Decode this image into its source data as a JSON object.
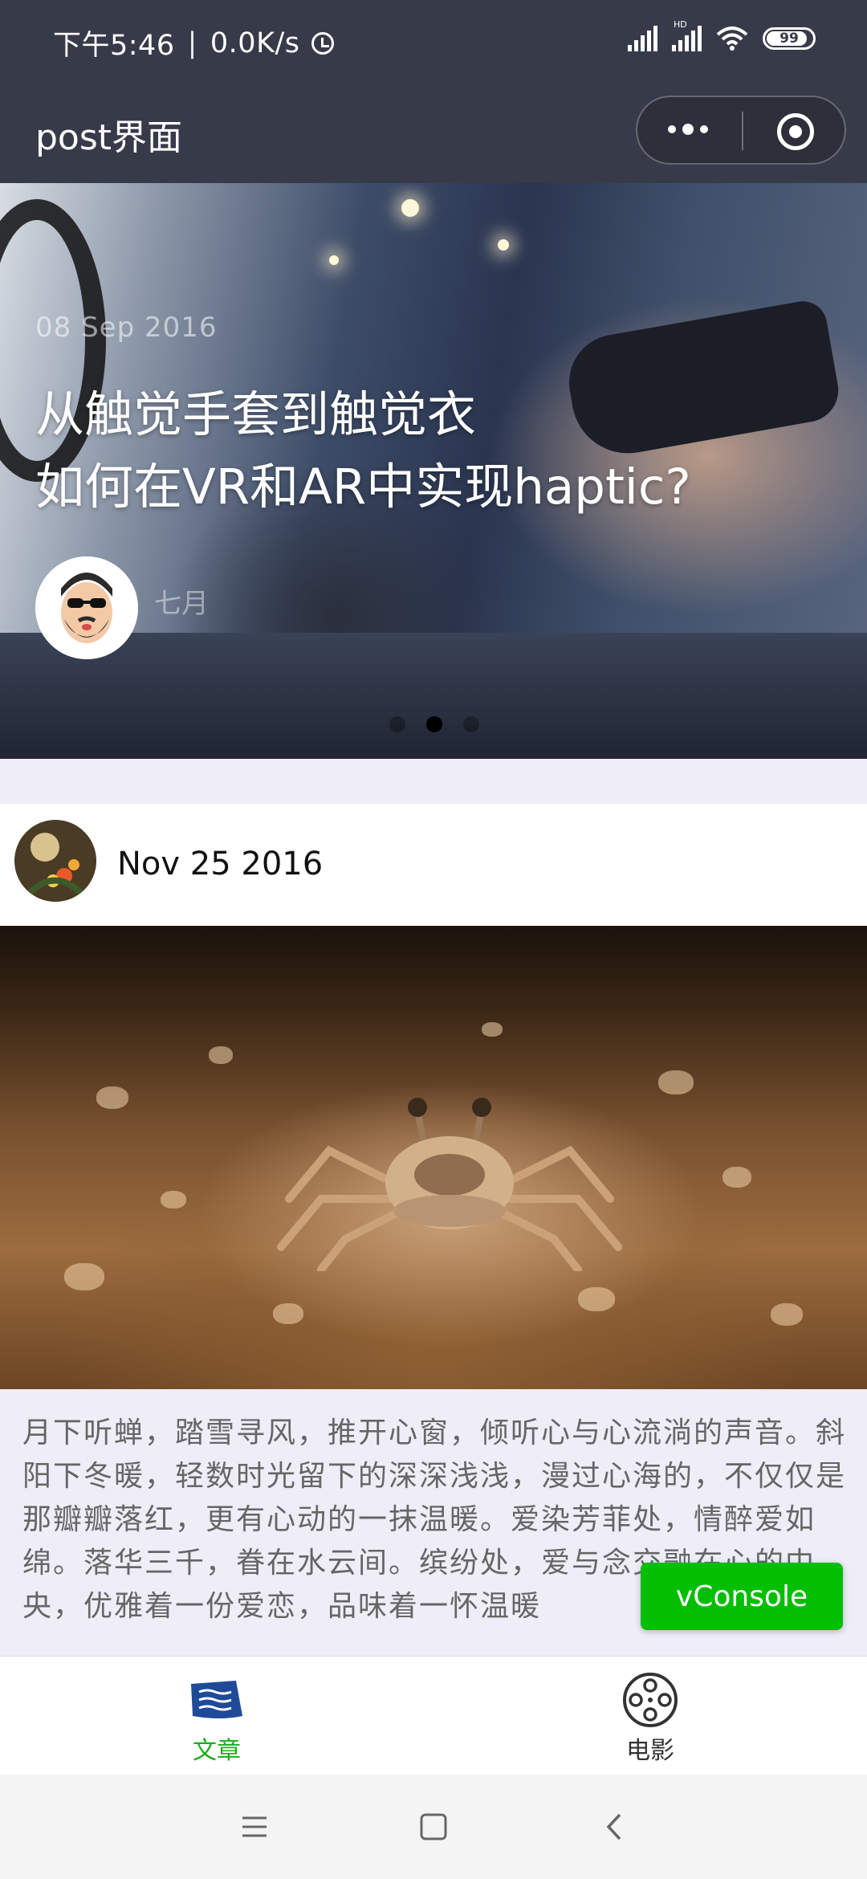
{
  "status_bar": {
    "time": "下午5:46",
    "network_speed": "0.0K/s",
    "battery": "99"
  },
  "nav": {
    "title": "post界面"
  },
  "banner": {
    "date": "08 Sep 2016",
    "title_line1": "从触觉手套到触觉衣",
    "title_line2": "如何在VR和AR中实现haptic?",
    "author": "七月",
    "indicator_count": 3,
    "active_index": 1
  },
  "post": {
    "date": "Nov 25 2016",
    "content": "月下听蝉，踏雪寻风，推开心窗，倾听心与心流淌的声音。斜阳下冬暖，轻数时光留下的深深浅浅，漫过心海的，不仅仅是那瓣瓣落红，更有心动的一抹温暖。爱染芳菲处，情醉爱如绵。落华三千，眷在水云间。缤纷处，爱与念交融在心的中央，优雅着一份爱恋，品味着一怀温暖"
  },
  "vconsole": {
    "label": "vConsole"
  },
  "tabbar": {
    "items": [
      {
        "label": "文章",
        "icon": "article-icon",
        "active": true
      },
      {
        "label": "电影",
        "icon": "film-reel-icon",
        "active": false
      }
    ],
    "active_color": "#1aad19",
    "inactive_color": "#333333"
  },
  "colors": {
    "header_bg": "#373a49",
    "page_bg": "#efedf8",
    "accent_green": "#04be02"
  }
}
